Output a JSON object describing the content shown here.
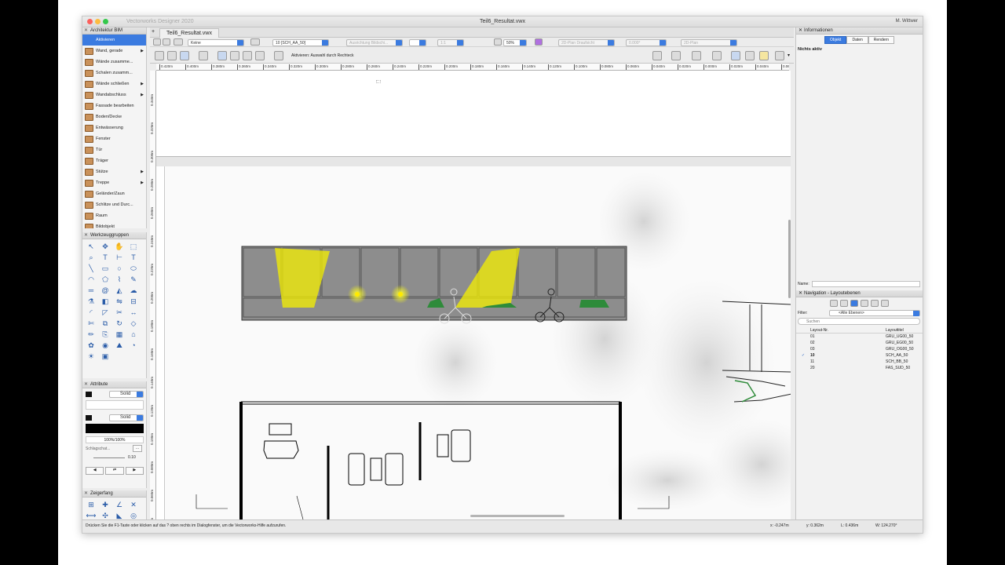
{
  "window": {
    "app_title": "Vectorworks Designer 2020",
    "doc_title": "Teil6_Resultat.vwx",
    "user": "M. Wittwer",
    "tab": "Teil6_Resultat.vwx"
  },
  "palettes": {
    "bim": {
      "title": "Architektur BIM",
      "items": [
        {
          "label": "Aktivieren",
          "active": true,
          "sub": false
        },
        {
          "label": "Wand, gerade",
          "sub": true
        },
        {
          "label": "Wände zusamme...",
          "sub": false
        },
        {
          "label": "Schalen zusamm...",
          "sub": false
        },
        {
          "label": "Wände schließen",
          "sub": true
        },
        {
          "label": "Wandabschluss",
          "sub": true
        },
        {
          "label": "Fassade bearbeiten",
          "sub": false
        },
        {
          "label": "Boden/Decke",
          "sub": false
        },
        {
          "label": "Entwässerung",
          "sub": false
        },
        {
          "label": "Fenster",
          "sub": false
        },
        {
          "label": "Tür",
          "sub": false
        },
        {
          "label": "Träger",
          "sub": false
        },
        {
          "label": "Stütze",
          "sub": true
        },
        {
          "label": "Treppe",
          "sub": true
        },
        {
          "label": "Geländer/Zaun",
          "sub": false
        },
        {
          "label": "Schlitze und Durc...",
          "sub": false
        },
        {
          "label": "Raum",
          "sub": false
        },
        {
          "label": "Bildobjekt",
          "sub": false
        }
      ]
    },
    "tool_groups": {
      "title": "Werkzeuggruppen"
    },
    "attributes": {
      "title": "Attribute",
      "fill_style": "Solid",
      "pen_style": "Solid",
      "opacity": "100%/100%",
      "shadow": "Schlagschat...",
      "line_weight": "0.10"
    },
    "snapping": {
      "title": "Zeigerfang"
    }
  },
  "toolbar": {
    "class_select": "Keine",
    "layer_select": "10 [SCH_AA_50]",
    "render_align": "Ausrichtung Bildschi...",
    "scale_value": "1:1",
    "zoom": "50%",
    "view": "2D-Plan Draufsicht",
    "angle": "0.000°",
    "projection": "2D-Plan",
    "mode_hint": "Aktivieren: Auswahl durch Rechteck"
  },
  "ruler": {
    "h_ticks": [
      "0.420m",
      "0.400m",
      "0.380m",
      "0.360m",
      "0.340m",
      "0.320m",
      "0.300m",
      "0.280m",
      "0.260m",
      "0.240m",
      "0.220m",
      "0.200m",
      "0.180m",
      "0.160m",
      "0.140m",
      "0.120m",
      "0.100m",
      "0.080m",
      "0.060m",
      "0.040m",
      "0.020m",
      "0.000m",
      "0.020m",
      "0.040m",
      "0.060m"
    ],
    "v_ticks": [
      "0.340m",
      "0.320m",
      "0.300m",
      "0.280m",
      "0.260m",
      "0.240m",
      "0.220m",
      "0.200m",
      "0.180m",
      "0.160m",
      "0.140m",
      "0.120m",
      "0.100m",
      "0.080m",
      "0.060m",
      "0.040m"
    ]
  },
  "info_panel": {
    "title": "Informationen",
    "tabs": [
      "Objekt",
      "Daten",
      "Rendern"
    ],
    "active_tab": "Objekt",
    "status": "Nichts aktiv",
    "name_label": "Name:"
  },
  "navigation": {
    "title": "Navigation - Layoutebenen",
    "filter_label": "Filter:",
    "filter_value": "<Alle Ebenen>",
    "search_placeholder": "Suchen",
    "col_nr": "Layout-Nr.",
    "col_title": "Layouttitel",
    "rows": [
      {
        "nr": "01",
        "title": "GRU_UG00_50",
        "active": false
      },
      {
        "nr": "02",
        "title": "GRU_EG00_50",
        "active": false
      },
      {
        "nr": "03",
        "title": "GRU_OG00_50",
        "active": false
      },
      {
        "nr": "10",
        "title": "SCH_AA_50",
        "active": true
      },
      {
        "nr": "11",
        "title": "SCH_BB_50",
        "active": false
      },
      {
        "nr": "20",
        "title": "FAS_SUD_50",
        "active": false
      }
    ]
  },
  "statusbar": {
    "hint": "Drücken Sie die F1-Taste oder klicken auf das ? oben rechts im Dialogfenster, um die Vectorworks-Hilfe aufzurufen.",
    "x": "x: -0.247m",
    "y": "y: 0.362m",
    "l": "L: 0.436m",
    "w": "W: 124.270°"
  },
  "colors": {
    "accent": "#3b7be0",
    "highlight_yellow": "#f5f000",
    "plant_green": "#2e8b3a"
  }
}
